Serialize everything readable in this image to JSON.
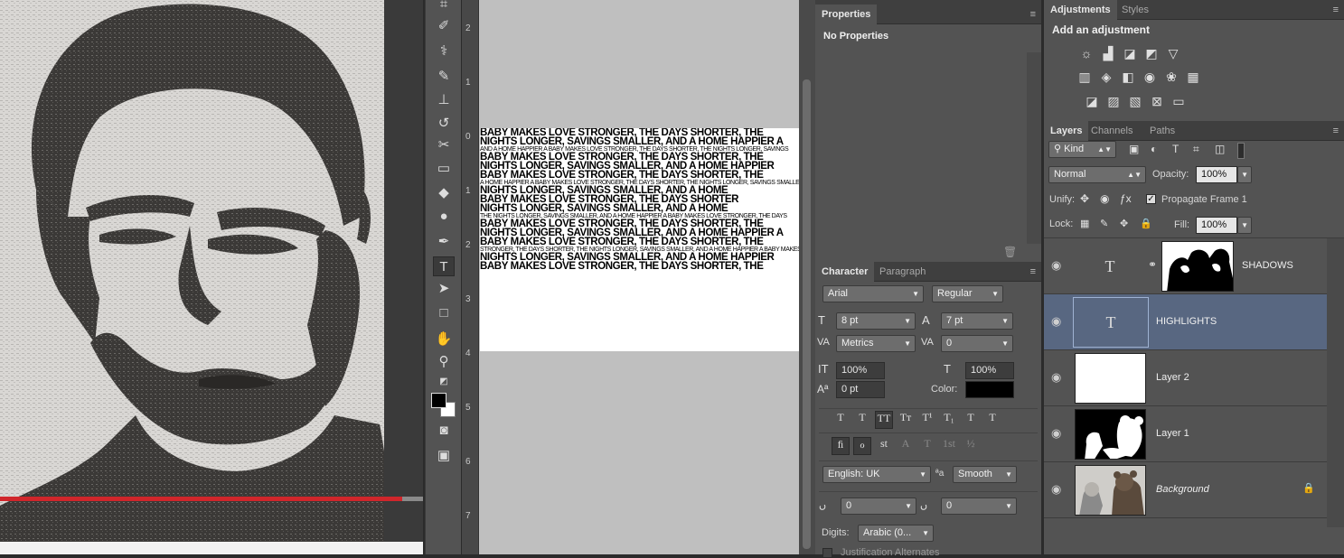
{
  "video": {
    "progress_pct": 95
  },
  "ruler": {
    "marks": [
      "2",
      "1",
      "0",
      "1",
      "2",
      "3",
      "4",
      "5",
      "6",
      "7"
    ]
  },
  "canvas": {
    "text_lines_bold": [
      "BABY MAKES LOVE STRONGER, THE DAYS SHORTER, THE",
      "NIGHTS LONGER, SAVINGS SMALLER, AND A HOME HAPPIER A",
      "BABY MAKES LOVE STRONGER, THE DAYS SHORTER, THE",
      "NIGHTS LONGER, SAVINGS SMALLER, AND A HOME HAPPIER",
      "BABY MAKES LOVE STRONGER, THE DAYS SHORTER, THE",
      "NIGHTS LONGER, SAVINGS SMALLER, AND A HOME",
      "BABY MAKES LOVE STRONGER, THE DAYS SHORTER",
      "NIGHTS LONGER, SAVINGS SMALLER, AND A HOME"
    ],
    "text_lines_small": [
      "A HOME HAPPIER A BABY MAKES LOVE STRONGER, THE DAYS SHORTER, THE NIGHTS LONGER, SAVINGS SMALLER",
      "STRONGER, THE DAYS SHORTER, THE NIGHTS LONGER, SAVINGS SMALLER, AND A HOME HAPPIER A BABY MAKES",
      "AND A HOME HAPPIER A BABY MAKES LOVE STRONGER, THE DAYS SHORTER, THE NIGHTS LONGER, SAVINGS",
      "THE NIGHTS LONGER, SAVINGS SMALLER, AND A HOME HAPPIER A BABY MAKES LOVE STRONGER, THE DAYS",
      "ABY SHORTER, THE NIGHTS LONGER, SAVINGS SMALLER, AND A HOME HAPPIER A BABY MAKES LOVE STRONGER"
    ]
  },
  "properties": {
    "tab": "Properties",
    "message": "No Properties"
  },
  "character": {
    "tabs": [
      "Character",
      "Paragraph"
    ],
    "font_family": "Arial",
    "font_style": "Regular",
    "font_size": "8 pt",
    "leading": "7 pt",
    "kerning": "Metrics",
    "tracking": "0",
    "vertical_scale": "100%",
    "horizontal_scale": "100%",
    "baseline_shift": "0 pt",
    "color_label": "Color:",
    "color_value": "#000000",
    "style_buttons": [
      "T",
      "T",
      "TT",
      "Tт",
      "T¹",
      "T₁",
      "T",
      "T"
    ],
    "opentype_buttons": [
      "ﬁ",
      "ℴ",
      "st",
      "A",
      "T",
      "1st",
      "½"
    ],
    "language": "English: UK",
    "aa_label": "ªa",
    "antialias": "Smooth",
    "kashida_left": "0",
    "kashida_right": "0",
    "digits_label": "Digits:",
    "digits_value": "Arabic (0...",
    "justification_label": "Justification Alternates"
  },
  "adjustments": {
    "tabs": [
      "Adjustments",
      "Styles"
    ],
    "title": "Add an adjustment",
    "row1": [
      "brightness-icon",
      "levels-icon",
      "curves-icon",
      "exposure-icon",
      "gradient-triangle-icon"
    ],
    "row2": [
      "vibrance-icon",
      "hue-icon",
      "color-balance-icon",
      "photo-filter-icon",
      "channel-mixer-icon",
      "lookup-icon"
    ],
    "row3": [
      "invert-icon",
      "posterize-icon",
      "threshold-icon",
      "selective-color-icon",
      "gradient-map-icon"
    ]
  },
  "layers": {
    "tabs": [
      "Layers",
      "Channels",
      "Paths"
    ],
    "filter_kind": "Kind",
    "blend_mode": "Normal",
    "opacity_label": "Opacity:",
    "opacity": "100%",
    "unify_label": "Unify:",
    "propagate_label": "Propagate Frame 1",
    "lock_label": "Lock:",
    "fill_label": "Fill:",
    "fill": "100%",
    "items": [
      {
        "name": "SHADOWS",
        "type": "text-with-mask"
      },
      {
        "name": "HIGHLIGHTS",
        "type": "text"
      },
      {
        "name": "Layer 2",
        "type": "white"
      },
      {
        "name": "Layer 1",
        "type": "mask"
      },
      {
        "name": "Background",
        "type": "photo"
      }
    ]
  }
}
